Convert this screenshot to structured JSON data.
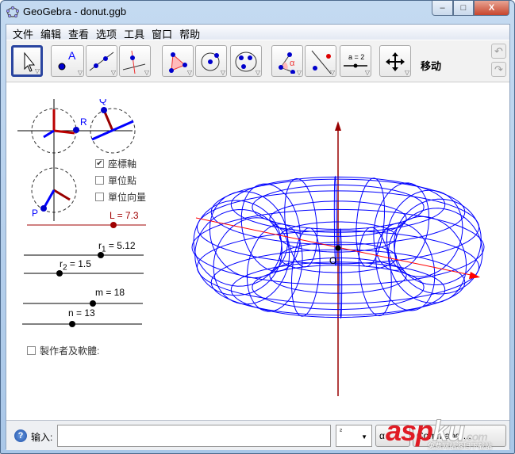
{
  "window": {
    "title": "GeoGebra - donut.ggb",
    "min": "–",
    "max": "□",
    "close": "X"
  },
  "menu": [
    "文件",
    "编辑",
    "查看",
    "选项",
    "工具",
    "窗口",
    "帮助"
  ],
  "toolbar": {
    "tools": [
      "move",
      "point",
      "line",
      "perpendicular",
      "polygon",
      "circle",
      "conic",
      "angle",
      "reflect",
      "slider",
      "move-graphics"
    ],
    "current_tool_label": "移动",
    "slider_tool_text": "a = 2",
    "angle_tool_text": "α"
  },
  "graphics": {
    "checkboxes": [
      {
        "label": "座標軸",
        "checked": true
      },
      {
        "label": "單位點",
        "checked": false
      },
      {
        "label": "單位向量",
        "checked": false
      }
    ],
    "points": {
      "p": "P",
      "q": "Q",
      "r": "R",
      "origin": "O"
    },
    "sliders": [
      {
        "name": "L",
        "label": "L = 7.3",
        "value": 7.3,
        "fraction": 0.73,
        "color": "#a00000"
      },
      {
        "name": "r1",
        "label_main": "r",
        "label_sub": "1",
        "label_val": " = 5.12",
        "value": 5.12,
        "fraction": 0.64
      },
      {
        "name": "r2",
        "label_main": "r",
        "label_sub": "2",
        "label_val": " = 1.5",
        "value": 1.5,
        "fraction": 0.3
      },
      {
        "name": "m",
        "label": "m = 18",
        "value": 18,
        "fraction": 0.58
      },
      {
        "name": "n",
        "label": "n = 13",
        "value": 13,
        "fraction": 0.42
      }
    ],
    "author_checkbox": {
      "label": "製作者及軟體:",
      "checked": false
    },
    "torus_color": "#0000ff",
    "axis_color": "#ff0000",
    "vaxis_color": "#990000"
  },
  "input_bar": {
    "label": "输入:",
    "value": "",
    "symbol_select": "²",
    "alpha_button": "α",
    "command_button": "Command ..."
  },
  "watermark": {
    "main": "asp",
    "suffix": "ku",
    "dotcom": ".com",
    "sub": "免费网站源码下载站"
  }
}
